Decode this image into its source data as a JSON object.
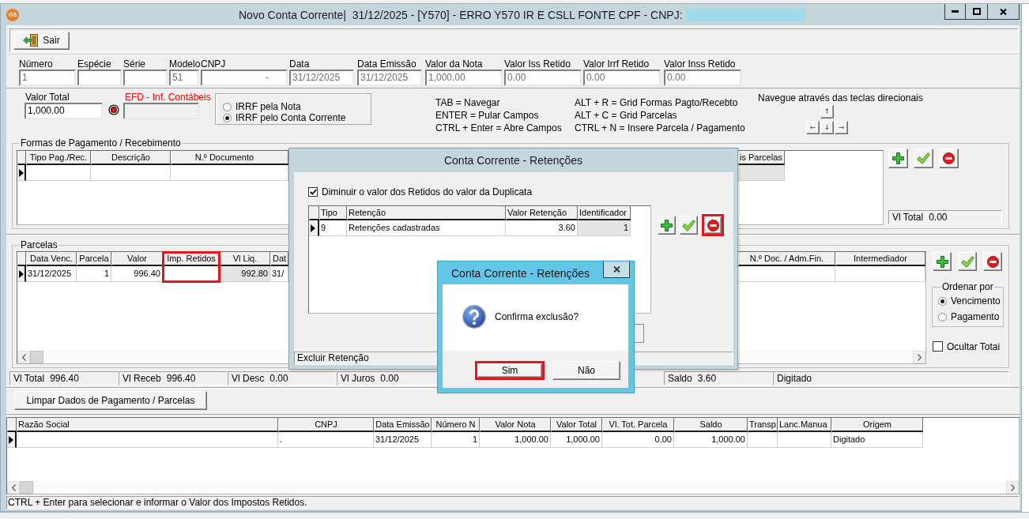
{
  "window": {
    "icon_text": "GS",
    "title": "Novo Conta Corrente|  31/12/2025 - [Y570] - ERRO Y570 IR E CSLL FONTE CPF - CNPJ:",
    "cnpj_redacted": true
  },
  "toolbar": {
    "buttons": [
      {
        "label": "Sair",
        "kind": "exit"
      }
    ]
  },
  "header_fields": [
    {
      "label": "Número",
      "value": "1",
      "readonly": true
    },
    {
      "label": "Espécie"
    },
    {
      "label": "Série"
    },
    {
      "label": "Modelo",
      "value": "51",
      "readonly": true
    },
    {
      "label": "CNPJ",
      "value": "-",
      "kind": "masked",
      "readonly": true
    },
    {
      "label": "Data",
      "value": "31/12/2025",
      "readonly": true
    },
    {
      "label": "Data Emissão",
      "value": "31/12/2025",
      "readonly": true
    },
    {
      "label": "Valor da Nota",
      "value": "1,000.00",
      "readonly": true
    },
    {
      "label": "Valor Iss Retido",
      "value": "0.00",
      "readonly": true
    },
    {
      "label": "Valor Irrf Retido",
      "value": "0.00",
      "readonly": true
    },
    {
      "label": "Valor Inss Retido",
      "value": "0.00",
      "readonly": true
    }
  ],
  "total_field": {
    "label": "Valor Total",
    "value": "1,000.00",
    "readonly": false
  },
  "efd_field": {
    "label": "EFD - Inf. Contábeis",
    "disabled": true
  },
  "irrf_options": [
    {
      "label": "IRRF pela Nota",
      "selected": false
    },
    {
      "label": "IRRF pelo Conta Corrente",
      "selected": true
    }
  ],
  "shortcuts": [
    {
      "lines": [
        "TAB = Navegar",
        "ENTER = Pular Campos",
        "CTRL + Enter = Abre Campos"
      ]
    },
    {
      "lines": [
        "ALT + R = Grid Formas Pagto/Recebto",
        "ALT + C = Grid Parcelas",
        "CTRL + N = Insere Parcela / Pagamento"
      ]
    }
  ],
  "navigation": {
    "hint": "Navegue através das teclas direcionais",
    "keys": [
      [
        "↑"
      ],
      [
        "←",
        "↓",
        "→"
      ]
    ]
  },
  "payment_forms": {
    "title": "Formas de Pagamento / Recebimento",
    "columns": [
      {
        "label": "Tipo Pag./Rec.",
        "kind": "code",
        "readonly": false
      },
      {
        "label": "Descrição",
        "kind": "code",
        "readonly": false
      },
      {
        "label": "N.º Documento",
        "kind": "code",
        "readonly": false
      },
      {
        "label": "is Parcelas",
        "kind": "text",
        "readonly": true
      }
    ],
    "rows": [
      {
        "selected": true
      }
    ],
    "actions": [
      {
        "kind": "add"
      },
      {
        "kind": "confirm"
      },
      {
        "kind": "delete"
      }
    ],
    "total": {
      "label": "Vl Total",
      "value": "0.00"
    }
  },
  "installments": {
    "title": "Parcelas",
    "columns": [
      {
        "label": "Data Venc.",
        "kind": "date",
        "readonly": false,
        "highlighted": false
      },
      {
        "label": "Parcela",
        "kind": "number",
        "readonly": false,
        "highlighted": false
      },
      {
        "label": "Valor",
        "kind": "number",
        "readonly": false,
        "highlighted": false
      },
      {
        "label": "Imp. Retidos",
        "kind": "number",
        "readonly": false,
        "highlighted": true
      },
      {
        "label": "Vl Liq.",
        "kind": "number",
        "readonly": true,
        "highlighted": false
      },
      {
        "label": "Dat",
        "kind": "date",
        "readonly": false,
        "highlighted": false
      },
      {
        "label": "N.º Doc. / Adm.Fin.",
        "kind": "code",
        "readonly": false,
        "highlighted": false
      },
      {
        "label": "Intermediador",
        "kind": "code",
        "readonly": false,
        "highlighted": false
      }
    ],
    "rows": [
      {
        "selected": true,
        "cells": [
          "31/12/2025",
          "1",
          "996.40",
          null,
          "992.80",
          "31/",
          null,
          null
        ]
      }
    ],
    "actions": [
      {
        "kind": "add"
      },
      {
        "kind": "confirm"
      },
      {
        "kind": "delete"
      }
    ],
    "sort": {
      "title": "Ordenar por",
      "options": [
        {
          "label": "Vencimento",
          "selected": true
        },
        {
          "label": "Pagamento",
          "selected": false
        }
      ]
    },
    "hide_totals": {
      "label": "Ocultar Totai",
      "checked": false
    }
  },
  "totals": [
    {
      "label": "Vl Total",
      "value": "996.40"
    },
    {
      "label": "Vl Receb",
      "value": "996.40"
    },
    {
      "label": "Vl Desc",
      "value": "0.00"
    },
    {
      "label": "Vl Juros",
      "value": "0.00"
    },
    {
      "label": "Saldo",
      "value": "3.60"
    },
    {
      "value": "Digitado"
    }
  ],
  "clear_button": {
    "label": "Limpar Dados de Pagamento / Parcelas"
  },
  "documents": {
    "columns": [
      {
        "label": "Razão Social",
        "kind": "text"
      },
      {
        "label": "CNPJ",
        "kind": "code"
      },
      {
        "label": "Data Emissão",
        "kind": "date"
      },
      {
        "label": "Número N",
        "kind": "number"
      },
      {
        "label": "Valor Nota",
        "kind": "number"
      },
      {
        "label": "Valor Total",
        "kind": "number"
      },
      {
        "label": "Vl. Tot. Parcela",
        "kind": "number"
      },
      {
        "label": "Saldo",
        "kind": "number"
      },
      {
        "label": "Transp",
        "kind": "text"
      },
      {
        "label": "Lanc.Manua",
        "kind": "text"
      },
      {
        "label": "Origem",
        "kind": "code"
      }
    ],
    "rows": [
      {
        "selected": true,
        "cells": [
          null,
          ".",
          "31/12/2025",
          "1",
          "1,000.00",
          "1,000.00",
          "0.00",
          "1,000.00",
          null,
          null,
          "Digitado"
        ]
      }
    ]
  },
  "status_bar": "CTRL + Enter para selecionar e informar o Valor dos Impostos Retidos.",
  "retention_dialog": {
    "title": "Conta Corrente - Retenções",
    "option": {
      "label": "Diminuir o valor dos Retidos do valor da Duplicata",
      "checked": true
    },
    "columns": [
      {
        "label": "Tipo",
        "kind": "text",
        "readonly": false
      },
      {
        "label": "Retenção",
        "kind": "text",
        "readonly": false
      },
      {
        "label": "Valor Retenção",
        "kind": "number",
        "readonly": false
      },
      {
        "label": "Identificador",
        "kind": "number",
        "readonly": true
      }
    ],
    "rows": [
      {
        "selected": true,
        "cells": [
          "9",
          "Retenções cadastradas",
          "3.60",
          "1"
        ]
      }
    ],
    "actions": [
      {
        "kind": "add",
        "highlighted": false
      },
      {
        "kind": "confirm",
        "highlighted": false
      },
      {
        "kind": "delete",
        "highlighted": true
      }
    ],
    "status": "Excluir Retenção"
  },
  "confirm_dialog": {
    "title": "Conta Corrente - Retenções",
    "message": "Confirma exclusão?",
    "buttons": [
      {
        "label": "Sim",
        "highlighted": true
      },
      {
        "label": "Não",
        "highlighted": false
      }
    ]
  }
}
